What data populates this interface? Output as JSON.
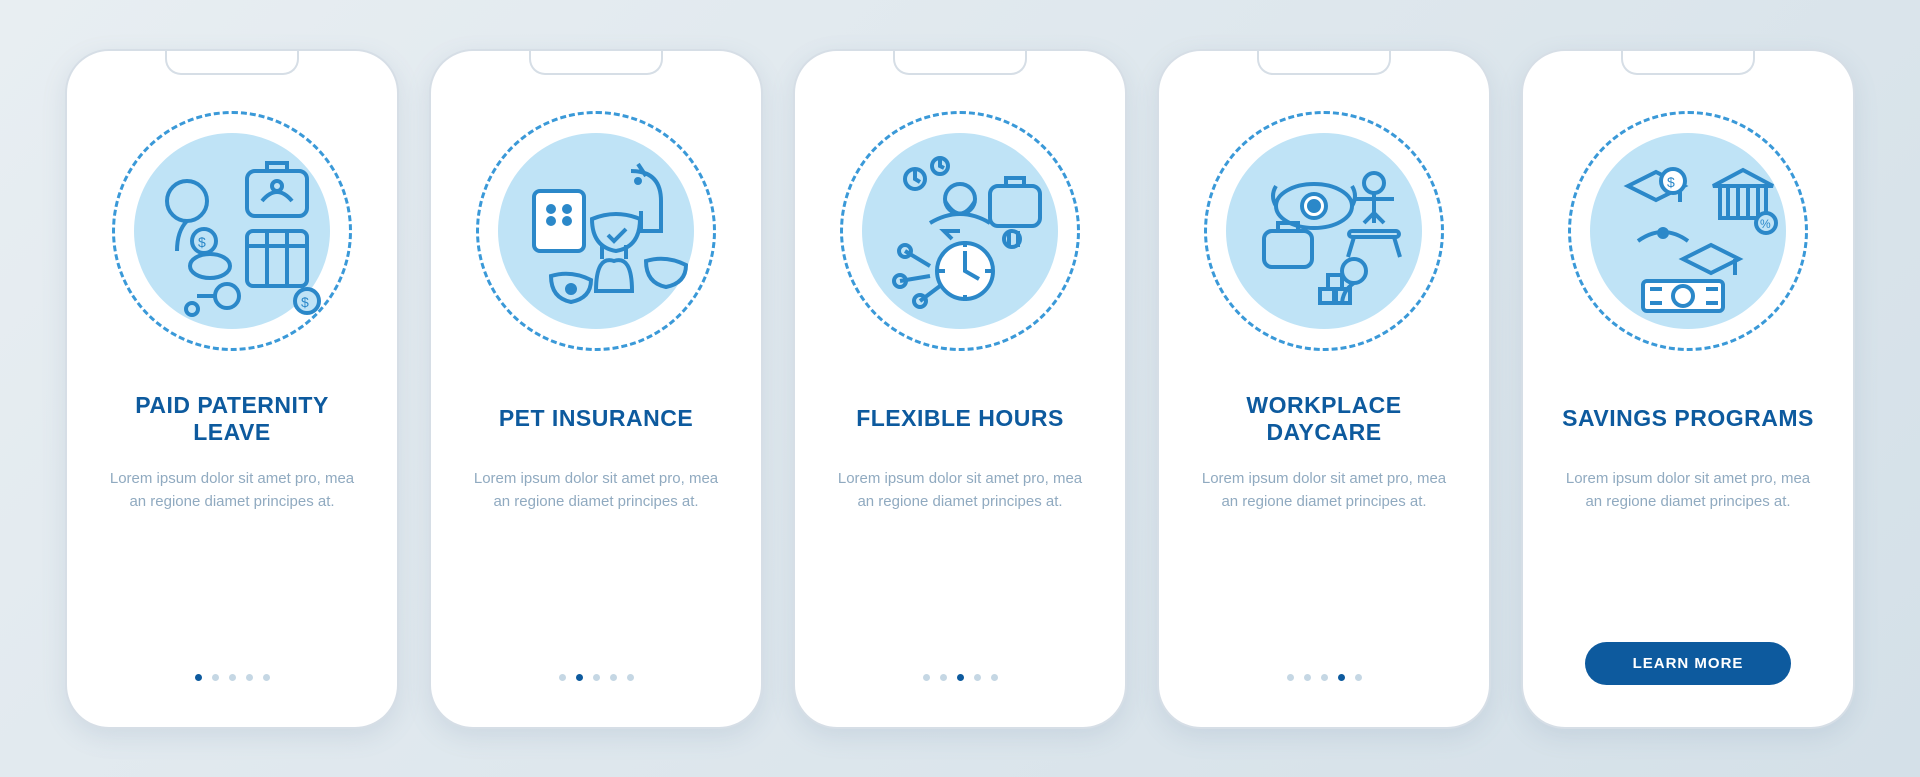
{
  "colors": {
    "primary": "#0d5a9e",
    "accent": "#3a99d8",
    "tint": "#bfe3f6",
    "muted": "#90aac0"
  },
  "screens": [
    {
      "icon": "paternity-leave-icon",
      "title": "PAID PATERNITY LEAVE",
      "desc": "Lorem ipsum dolor sit amet pro, mea an regione diamet principes at.",
      "active_dot": 0,
      "show_dots": true,
      "show_cta": false
    },
    {
      "icon": "pet-insurance-icon",
      "title": "PET INSURANCE",
      "desc": "Lorem ipsum dolor sit amet pro, mea an regione diamet principes at.",
      "active_dot": 1,
      "show_dots": true,
      "show_cta": false
    },
    {
      "icon": "flexible-hours-icon",
      "title": "FLEXIBLE HOURS",
      "desc": "Lorem ipsum dolor sit amet pro, mea an regione diamet principes at.",
      "active_dot": 2,
      "show_dots": true,
      "show_cta": false
    },
    {
      "icon": "workplace-daycare-icon",
      "title": "WORKPLACE DAYCARE",
      "desc": "Lorem ipsum dolor sit amet pro, mea an regione diamet principes at.",
      "active_dot": 3,
      "show_dots": true,
      "show_cta": false
    },
    {
      "icon": "savings-programs-icon",
      "title": "SAVINGS PROGRAMS",
      "desc": "Lorem ipsum dolor sit amet pro, mea an regione diamet principes at.",
      "active_dot": 4,
      "show_dots": false,
      "show_cta": true
    }
  ],
  "cta_label": "LEARN MORE",
  "dots_total": 5
}
